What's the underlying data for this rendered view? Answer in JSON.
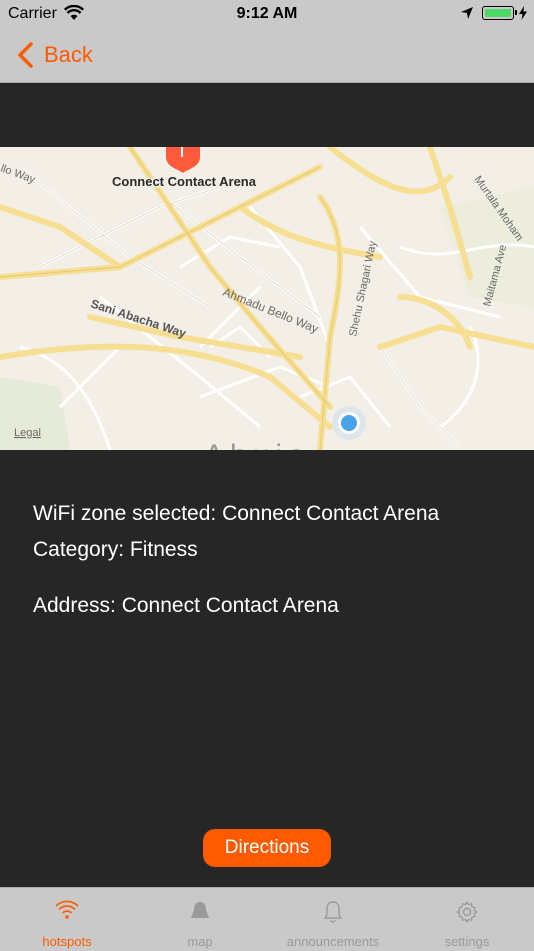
{
  "status_bar": {
    "carrier": "Carrier",
    "time": "9:12 AM"
  },
  "nav": {
    "back_label": "Back"
  },
  "map": {
    "pin_label": "Connect Contact Arena",
    "streets": [
      "Sani Abacha Way",
      "Ahmadu Bello Way",
      "Shehu Shagari Way",
      "Murtala Moham",
      "Maitama Ave",
      "llo Way"
    ],
    "city_label": "Abuja",
    "legal": "Legal"
  },
  "info": {
    "wifi_zone": "WiFi zone selected: Connect Contact Arena",
    "category": "Category: Fitness",
    "address": "Address: Connect Contact Arena"
  },
  "directions_label": "Directions",
  "tabs": [
    {
      "label": "hotspots",
      "icon": "wifi-icon",
      "active": true
    },
    {
      "label": "map",
      "icon": "map-icon",
      "active": false
    },
    {
      "label": "announcements",
      "icon": "bell-icon",
      "active": false
    },
    {
      "label": "settings",
      "icon": "gear-icon",
      "active": false
    }
  ],
  "colors": {
    "accent": "#ff5a00",
    "background": "#262626",
    "bars": "#c9c9c9"
  }
}
